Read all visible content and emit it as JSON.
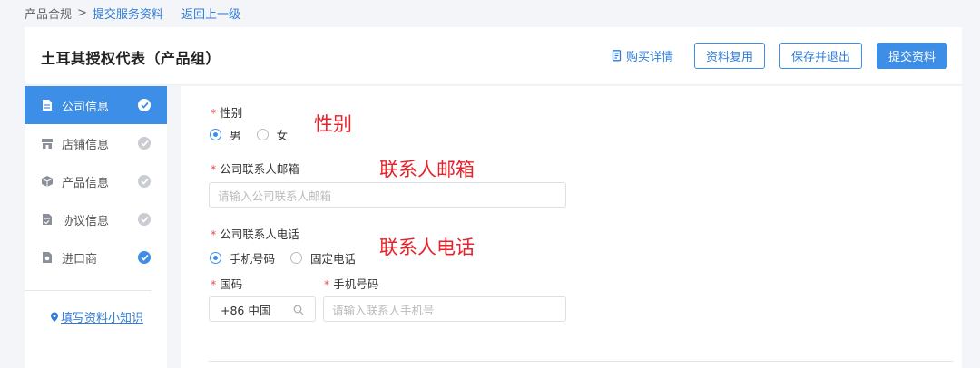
{
  "breadcrumb": {
    "root": "产品合规",
    "separator": ">",
    "current": "提交服务资料",
    "back": "返回上一级"
  },
  "header": {
    "title": "土耳其授权代表（产品组）",
    "purchase_link": "购买详情",
    "buttons": {
      "reuse": "资料复用",
      "save_exit": "保存并退出",
      "submit": "提交资料"
    }
  },
  "sidebar": {
    "items": [
      {
        "label": "公司信息",
        "icon": "document-icon",
        "checked": true,
        "active": true
      },
      {
        "label": "店铺信息",
        "icon": "store-icon",
        "checked": false,
        "active": false
      },
      {
        "label": "产品信息",
        "icon": "box-icon",
        "checked": false,
        "active": false
      },
      {
        "label": "协议信息",
        "icon": "agreement-icon",
        "checked": false,
        "active": false
      },
      {
        "label": "进口商",
        "icon": "importer-icon",
        "checked": true,
        "active": false
      }
    ],
    "tips_link": "填写资料小知识"
  },
  "form": {
    "gender": {
      "label": "性别",
      "options": [
        "男",
        "女"
      ],
      "selected": "男"
    },
    "email": {
      "label": "公司联系人邮箱",
      "placeholder": "请输入公司联系人邮箱"
    },
    "phone": {
      "label": "公司联系人电话",
      "options": [
        "手机号码",
        "固定电话"
      ],
      "selected": "手机号码"
    },
    "country_code": {
      "label": "国码",
      "value": "+86 中国"
    },
    "mobile": {
      "label": "手机号码",
      "placeholder": "请输入联系人手机号"
    }
  },
  "annotations": {
    "gender": "性别",
    "email": "联系人邮箱",
    "phone": "联系人电话"
  },
  "colors": {
    "primary": "#3d8ee6",
    "link": "#2f7cd8",
    "required": "#e94a4a",
    "annotation": "#e8212a",
    "background": "#f3f5f8"
  }
}
